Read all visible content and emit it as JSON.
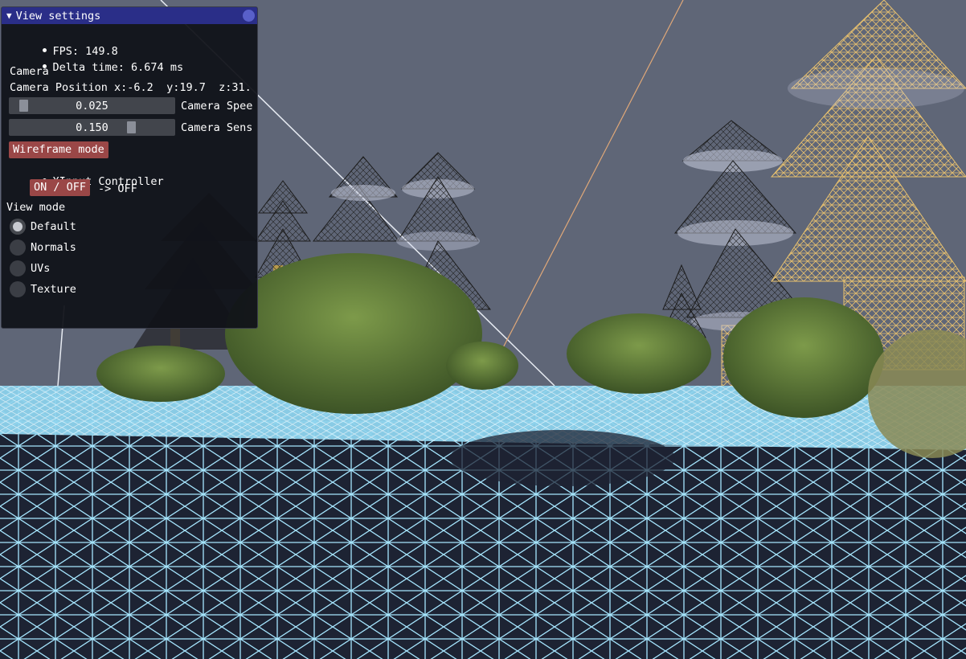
{
  "window": {
    "title": "View settings",
    "collapse_glyph": "▼"
  },
  "stats": {
    "fps_label": "FPS: 149.8",
    "delta_label": "Delta time: 6.674 ms"
  },
  "camera": {
    "header": "Camera",
    "position_label": "Camera Position x:-6.2  y:19.7  z:31.",
    "speed": {
      "value": "0.025",
      "level": 0.05,
      "label": "Camera Spee"
    },
    "sens": {
      "value": "0.150",
      "level": 0.76,
      "label": "Camera Sens"
    }
  },
  "wireframe_button": "Wireframe mode",
  "xinput": {
    "label": "XInput Controller",
    "toggle_label": "ON / OFF",
    "state_label": "-> OFF"
  },
  "view_mode": {
    "header": "View mode",
    "options": [
      "Default",
      "Normals",
      "UVs",
      "Texture"
    ],
    "selected": "Default"
  },
  "colors": {
    "sky": "#5f6677",
    "terrain_wire": "#a6e6ff",
    "tree_wire": "#e7c06e",
    "titlebar": "#2a2e88",
    "button": "#9a4747"
  }
}
